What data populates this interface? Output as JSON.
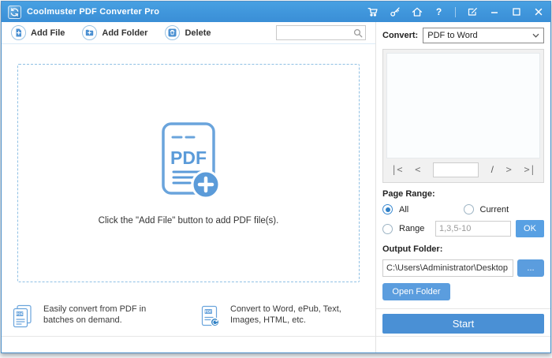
{
  "colors": {
    "titlebar": "#3f95da",
    "accent_button": "#58a0e3",
    "start_button": "#4a90d5",
    "dashed_border": "#8fc0e4",
    "radio_selected": "#2e7fc6"
  },
  "window": {
    "title": "Coolmuster PDF Converter Pro",
    "icons": {
      "help": "?"
    }
  },
  "toolbar": {
    "add_file": "Add File",
    "add_folder": "Add Folder",
    "delete": "Delete",
    "search": {
      "value": "",
      "placeholder": ""
    }
  },
  "dropzone": {
    "pdf_label": "PDF",
    "hint": "Click the \"Add File\" button to add PDF file(s)."
  },
  "features": [
    {
      "text": "Easily convert from PDF in batches on demand."
    },
    {
      "text": "Convert to Word, ePub, Text, Images, HTML, etc."
    }
  ],
  "panel": {
    "convert_label": "Convert:",
    "convert_value": "PDF to Word",
    "pager": {
      "first": "|<",
      "prev": "<",
      "page_value": "",
      "separator": "/",
      "next": ">",
      "last": ">|"
    },
    "page_range": {
      "label": "Page Range:",
      "all": "All",
      "current": "Current",
      "range": "Range",
      "range_hint": "1,3,5-10",
      "ok": "OK"
    },
    "output": {
      "label": "Output Folder:",
      "path": "C:\\Users\\Administrator\\Desktop",
      "browse": "...",
      "open_folder": "Open Folder"
    },
    "start": "Start"
  }
}
